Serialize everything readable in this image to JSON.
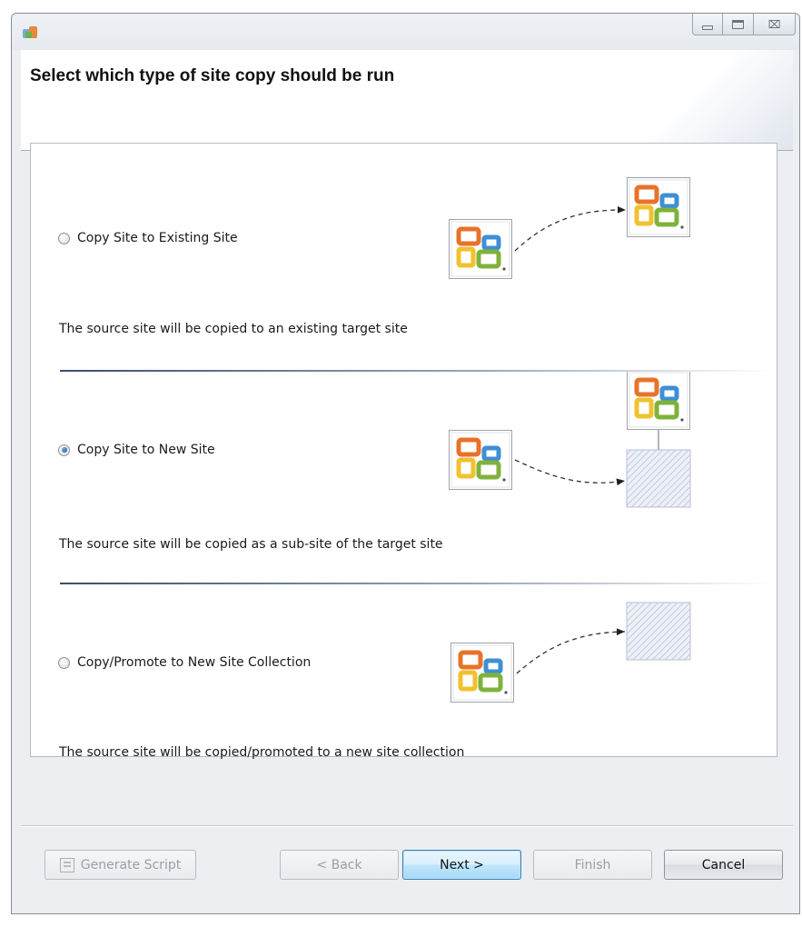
{
  "window": {
    "icon": "wizard-app-icon",
    "controls": [
      "minimize-icon",
      "maximize-icon",
      "close-icon"
    ],
    "close_glyph": "⌧"
  },
  "banner": {
    "title": "Select which type of site copy should be run"
  },
  "options": [
    {
      "label": "Copy Site to Existing Site",
      "description": "The source site will be copied to an existing target site",
      "selected": false,
      "diagram": "office-to-office"
    },
    {
      "label": "Copy Site to New Site",
      "description": "The source site will be copied as a sub-site of the target site",
      "selected": true,
      "diagram": "office-to-new-subsite"
    },
    {
      "label": "Copy/Promote to New Site Collection",
      "description": "The source site will be copied/promoted to a new site collection",
      "selected": false,
      "diagram": "office-to-new-collection"
    }
  ],
  "buttons": {
    "generate_script": "Generate Script",
    "back": "< Back",
    "next": "Next >",
    "finish": "Finish",
    "cancel": "Cancel"
  },
  "colors": {
    "accent": "#3c7fb1",
    "radio_selected": "#1d4f93",
    "office_orange": "#e8722a",
    "office_blue": "#3f8fd4",
    "office_green": "#7fb23a",
    "office_yellow": "#f2c12e"
  }
}
